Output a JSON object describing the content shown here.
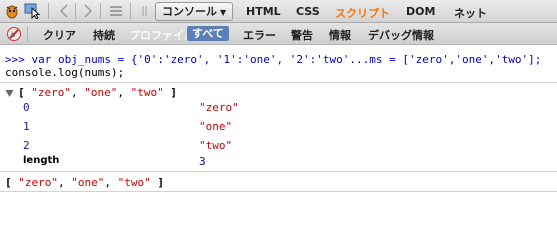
{
  "toolbar": {
    "tabs": [
      {
        "label": "コンソール",
        "active": true
      },
      {
        "label": "HTML"
      },
      {
        "label": "CSS"
      },
      {
        "label": "スクリプト",
        "highlight": "#f07818"
      },
      {
        "label": "DOM"
      },
      {
        "label": "ネット"
      }
    ],
    "icons": [
      "inspect-icon",
      "pointer-icon",
      "back-icon",
      "forward-icon",
      "list-icon"
    ]
  },
  "console_toolbar": {
    "clear_label": "クリア",
    "persist_label": "持続",
    "profile_label": "プロファイル",
    "filters": [
      {
        "label": "すべて",
        "active": true
      },
      {
        "label": "エラー"
      },
      {
        "label": "警告"
      },
      {
        "label": "情報"
      },
      {
        "label": "デバッグ情報"
      }
    ],
    "accent_color": "#5c7fb8"
  },
  "console": {
    "command_line_1": ">>> var obj_nums = {'0':'zero', '1':'one', '2':'two'...ms = ['zero','one','two'];",
    "command_line_2": "console.log(nums);",
    "log_array": {
      "open": "[",
      "items": [
        "\"zero\"",
        "\"one\"",
        "\"two\""
      ],
      "close": "]",
      "properties": [
        {
          "key": "0",
          "value": "\"zero\""
        },
        {
          "key": "1",
          "value": "\"one\""
        },
        {
          "key": "2",
          "value": "\"two\""
        },
        {
          "key": "length",
          "value": "3"
        }
      ]
    },
    "result": {
      "open": "[",
      "items": [
        "\"zero\"",
        "\"one\"",
        "\"two\""
      ],
      "close": "]"
    }
  }
}
